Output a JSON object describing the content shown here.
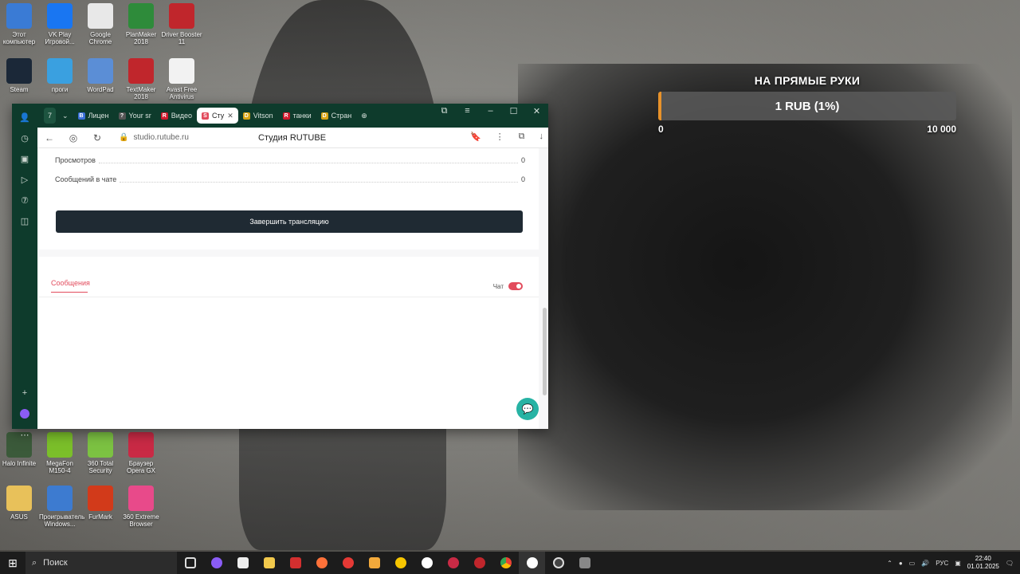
{
  "desktop": {
    "icons_top": [
      {
        "label": "Этот компьютер",
        "icon": "computer-icon",
        "color": "#3a7bd5"
      },
      {
        "label": "VK Play Игровой...",
        "icon": "vkplay-icon",
        "color": "#1976f2"
      },
      {
        "label": "Google Chrome",
        "icon": "chrome-icon",
        "color": "#e8e8e8"
      },
      {
        "label": "PlanMaker 2018",
        "icon": "planmaker-icon",
        "color": "#2e8b3a"
      },
      {
        "label": "Driver Booster 11",
        "icon": "driverbooster-icon",
        "color": "#c0262c"
      }
    ],
    "icons_row2": [
      {
        "label": "Steam",
        "icon": "steam-icon",
        "color": "#1b2838"
      },
      {
        "label": "проги",
        "icon": "folder-icon",
        "color": "#3aa0e0"
      },
      {
        "label": "WordPad",
        "icon": "wordpad-icon",
        "color": "#5b8ed6"
      },
      {
        "label": "TextMaker 2018",
        "icon": "textmaker-icon",
        "color": "#c0262c"
      },
      {
        "label": "Avast Free Antivirus",
        "icon": "file-icon",
        "color": "#f2f2f2"
      }
    ],
    "icons_bottom": [
      {
        "label": "Halo Infinite",
        "icon": "halo-icon",
        "color": "#3b5a3a"
      },
      {
        "label": "MegaFon M150-4",
        "icon": "megafon-icon",
        "color": "#7bbf2a"
      },
      {
        "label": "360 Total Security",
        "icon": "360-icon",
        "color": "#7cc242"
      },
      {
        "label": "Браузер Opera GX",
        "icon": "operagx-icon",
        "color": "#c92a45"
      }
    ],
    "icons_bottom2": [
      {
        "label": "ASUS",
        "icon": "folder-icon",
        "color": "#e8c15a"
      },
      {
        "label": "Проигрыватель Windows...",
        "icon": "media-player-icon",
        "color": "#3d7bd0"
      },
      {
        "label": "FurMark",
        "icon": "furmark-icon",
        "color": "#d23a1a"
      },
      {
        "label": "360 Extreme Browser",
        "icon": "360browser-icon",
        "color": "#e84a8a"
      }
    ]
  },
  "donation": {
    "title": "НА ПРЯМЫЕ РУКИ",
    "amount": "1 RUB (1%)",
    "progress_fraction": 0.01,
    "min": "0",
    "max": "10 000",
    "accent": "#e8922a"
  },
  "browser": {
    "tab_counter": "7",
    "tabs": [
      {
        "label": "Лицен",
        "icon_color": "#3a6fd8",
        "icon_char": "B"
      },
      {
        "label": "Your sr",
        "icon_color": "#555",
        "icon_char": "?"
      },
      {
        "label": "Видео",
        "icon_color": "#d2192d",
        "icon_char": "R"
      },
      {
        "label": "Сту",
        "icon_color": "#e24b5c",
        "icon_char": "S",
        "active": true
      },
      {
        "label": "Vitson",
        "icon_color": "#d8a313",
        "icon_char": "D"
      },
      {
        "label": "танки",
        "icon_color": "#d2192d",
        "icon_char": "R"
      },
      {
        "label": "Стран",
        "icon_color": "#d8a313",
        "icon_char": "D"
      }
    ],
    "url": "studio.rutube.ru",
    "page_title": "Студия RUTUBE",
    "stats": [
      {
        "label": "Просмотров",
        "value": "0"
      },
      {
        "label": "Сообщений в чате",
        "value": "0"
      }
    ],
    "end_button": "Завершить трансляцию",
    "messages_tab": "Сообщения",
    "chat_label": "Чат",
    "accent": "#e24b5c"
  },
  "taskbar": {
    "search_placeholder": "Поиск",
    "language": "РУС",
    "time": "22:40",
    "date": "01.01.2025"
  }
}
